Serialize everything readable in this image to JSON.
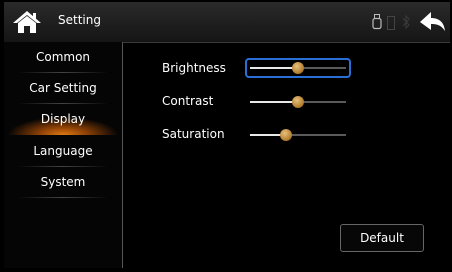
{
  "header": {
    "title": "Setting",
    "icons": [
      "home-icon",
      "usb-icon",
      "phone-icon",
      "bluetooth-icon",
      "back-arrow-icon"
    ]
  },
  "sidebar": {
    "items": [
      {
        "label": "Common"
      },
      {
        "label": "Car Setting"
      },
      {
        "label": "Display",
        "active": true
      },
      {
        "label": "Language"
      },
      {
        "label": "System"
      }
    ]
  },
  "display": {
    "settings": [
      {
        "label": "Brightness",
        "value": 0.5,
        "focused": true
      },
      {
        "label": "Contrast",
        "value": 0.5
      },
      {
        "label": "Saturation",
        "value": 0.38
      }
    ],
    "default_label": "Default"
  },
  "colors": {
    "accent_active": "#e07a12",
    "focus_outline": "#2a6fd6",
    "thumb": "#c8953f"
  }
}
